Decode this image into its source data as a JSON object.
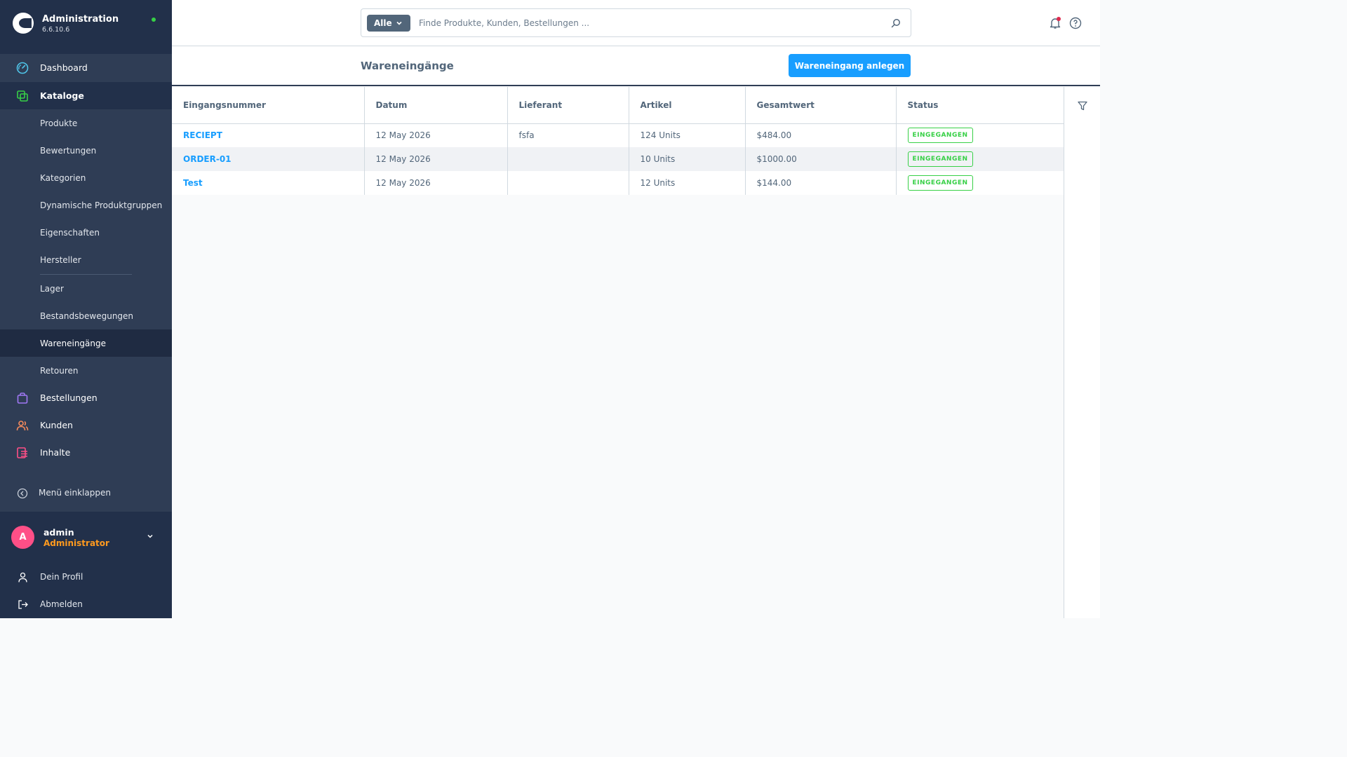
{
  "brand": {
    "title": "Administration",
    "version": "6.6.10.6"
  },
  "nav": {
    "dashboard": "Dashboard",
    "kataloge": "Kataloge",
    "sub": [
      "Produkte",
      "Bewertungen",
      "Kategorien",
      "Dynamische Produktgruppen",
      "Eigenschaften",
      "Hersteller",
      "Lager",
      "Bestandsbewegungen",
      "Wareneingänge",
      "Retouren"
    ],
    "bestellungen": "Bestellungen",
    "kunden": "Kunden",
    "inhalte": "Inhalte",
    "collapse": "Menü einklappen"
  },
  "user": {
    "initial": "A",
    "name": "admin",
    "role": "Administrator"
  },
  "bottom": {
    "profile": "Dein Profil",
    "logout": "Abmelden"
  },
  "search": {
    "type": "Alle",
    "placeholder": "Finde Produkte, Kunden, Bestellungen ..."
  },
  "page": {
    "title": "Wareneingänge",
    "create_button": "Wareneingang anlegen"
  },
  "table": {
    "columns": [
      "Eingangsnummer",
      "Datum",
      "Lieferant",
      "Artikel",
      "Gesamtwert",
      "Status"
    ],
    "rows": [
      {
        "number": "RECIEPT",
        "date": "12 May 2026",
        "supplier": "fsfa",
        "items": "124 Units",
        "total": "$484.00",
        "status": "EINGEGANGEN"
      },
      {
        "number": "ORDER-01",
        "date": "12 May 2026",
        "supplier": "",
        "items": "10 Units",
        "total": "$1000.00",
        "status": "EINGEGANGEN"
      },
      {
        "number": "Test",
        "date": "12 May 2026",
        "supplier": "",
        "items": "12 Units",
        "total": "$144.00",
        "status": "EINGEGANGEN"
      }
    ]
  },
  "colors": {
    "sidebar": "#2f3d55",
    "accent": "#189eff",
    "status_green": "#37d046",
    "role_orange": "#ff9a1e",
    "avatar_pink": "#ff4f87"
  }
}
